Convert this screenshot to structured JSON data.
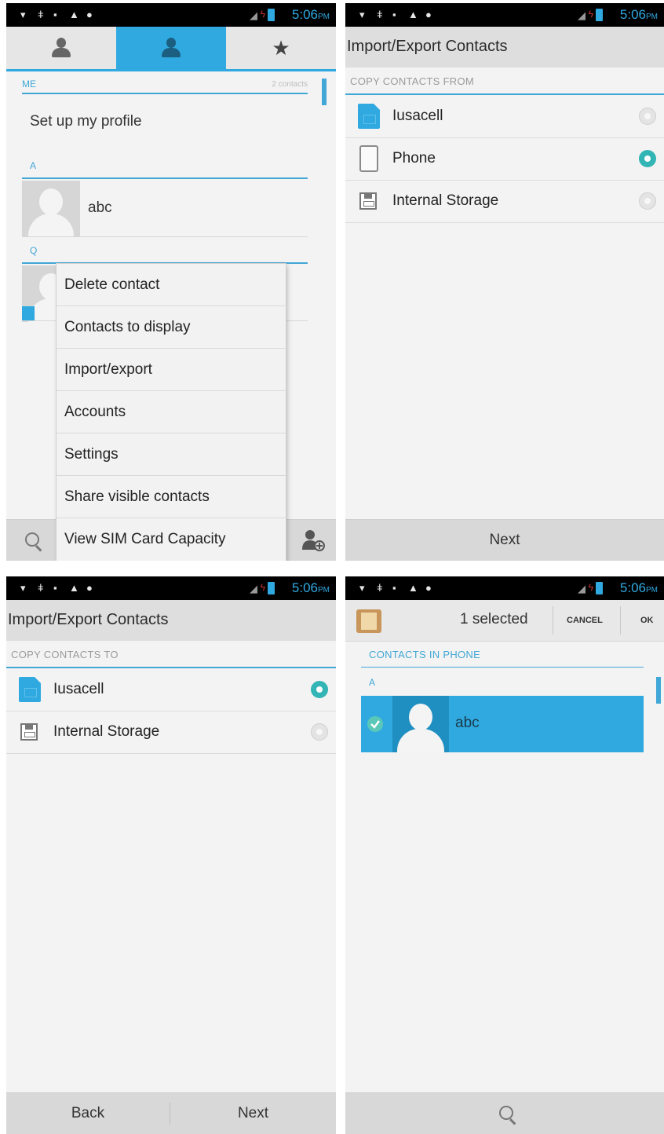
{
  "status_bar": {
    "time": "5:06",
    "ampm": "PM"
  },
  "screen1": {
    "tabs": [
      "groups-icon",
      "person-icon",
      "star-icon"
    ],
    "me_header": "ME",
    "contact_count": "2 contacts",
    "profile_text": "Set up my profile",
    "section_a": "A",
    "contact_a": "abc",
    "section_q": "Q",
    "menu": [
      "Delete contact",
      "Contacts to display",
      "Import/export",
      "Accounts",
      "Settings",
      "Share visible contacts",
      "View SIM Card Capacity"
    ]
  },
  "screen2": {
    "title": "Import/Export Contacts",
    "section": "COPY CONTACTS FROM",
    "options": [
      {
        "label": "Iusacell",
        "icon": "sim-icon",
        "selected": false
      },
      {
        "label": "Phone",
        "icon": "phone-icon",
        "selected": true
      },
      {
        "label": "Internal Storage",
        "icon": "storage-icon",
        "selected": false
      }
    ],
    "next_label": "Next"
  },
  "screen3": {
    "title": "Import/Export Contacts",
    "section": "COPY CONTACTS TO",
    "options": [
      {
        "label": "Iusacell",
        "icon": "sim-icon",
        "selected": true
      },
      {
        "label": "Internal Storage",
        "icon": "storage-icon",
        "selected": false
      }
    ],
    "back_label": "Back",
    "next_label": "Next"
  },
  "screen4": {
    "selected_text": "1 selected",
    "cancel_label": "CANCEL",
    "ok_label": "OK",
    "section": "CONTACTS IN PHONE",
    "alpha": "A",
    "contact_name": "abc"
  },
  "colors": {
    "accent": "#2fa9e0",
    "selected_row": "#2fa9e0",
    "radio_on": "#33b5b5"
  }
}
